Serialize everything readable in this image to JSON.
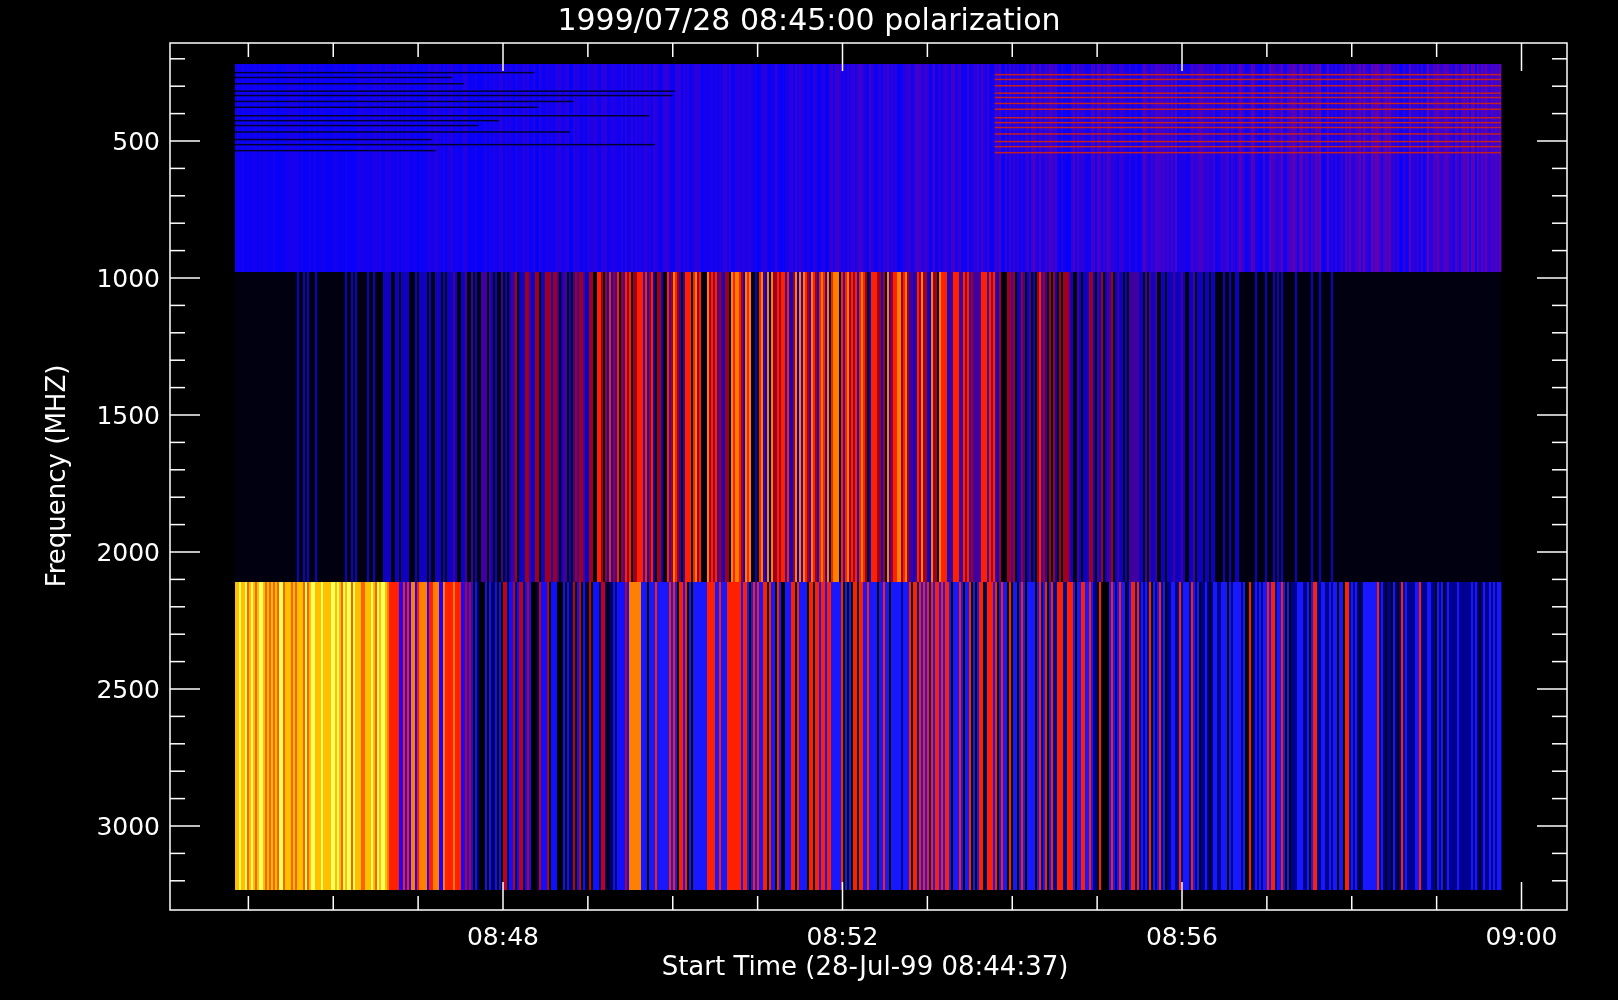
{
  "title": "1999/07/28 08:45:00 polarization",
  "y_axis": {
    "label": "Frequency (MHZ)",
    "ticks": [
      "500",
      "1000",
      "1500",
      "2000",
      "2500",
      "3000"
    ]
  },
  "x_axis": {
    "label": "Start Time (28-Jul-99 08:44:37)",
    "ticks": [
      "08:48",
      "08:52",
      "08:56",
      "09:00"
    ]
  }
}
